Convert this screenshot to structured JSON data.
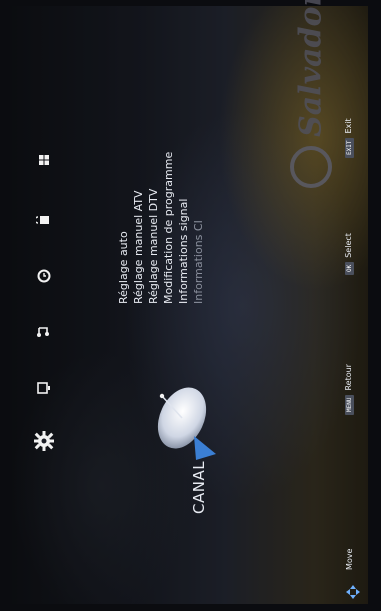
{
  "brand": {
    "name": "Salvador"
  },
  "canal_label": "CANAL",
  "menu": {
    "items": [
      {
        "label": "Réglage auto"
      },
      {
        "label": "Réglage manuel ATV"
      },
      {
        "label": "Réglage manuel DTV"
      },
      {
        "label": "Modification de programme"
      },
      {
        "label": "Informations signal"
      },
      {
        "label": "Informations CI"
      }
    ]
  },
  "top_icons": [
    {
      "name": "gear-icon"
    },
    {
      "name": "picture-icon"
    },
    {
      "name": "sound-icon"
    },
    {
      "name": "time-icon"
    },
    {
      "name": "lock-icon"
    },
    {
      "name": "setup-icon"
    }
  ],
  "help_bar": {
    "move_label": "Move",
    "menu_key": "MENU",
    "retour_label": "Retour",
    "ok_key": "OK",
    "select_label": "Select",
    "exit_key": "EXIT",
    "exit_label": "Exit"
  },
  "colors": {
    "text": "#e8ebf2",
    "disabled_text": "#8a8f9c",
    "dish_accent": "#3b7fd4"
  }
}
